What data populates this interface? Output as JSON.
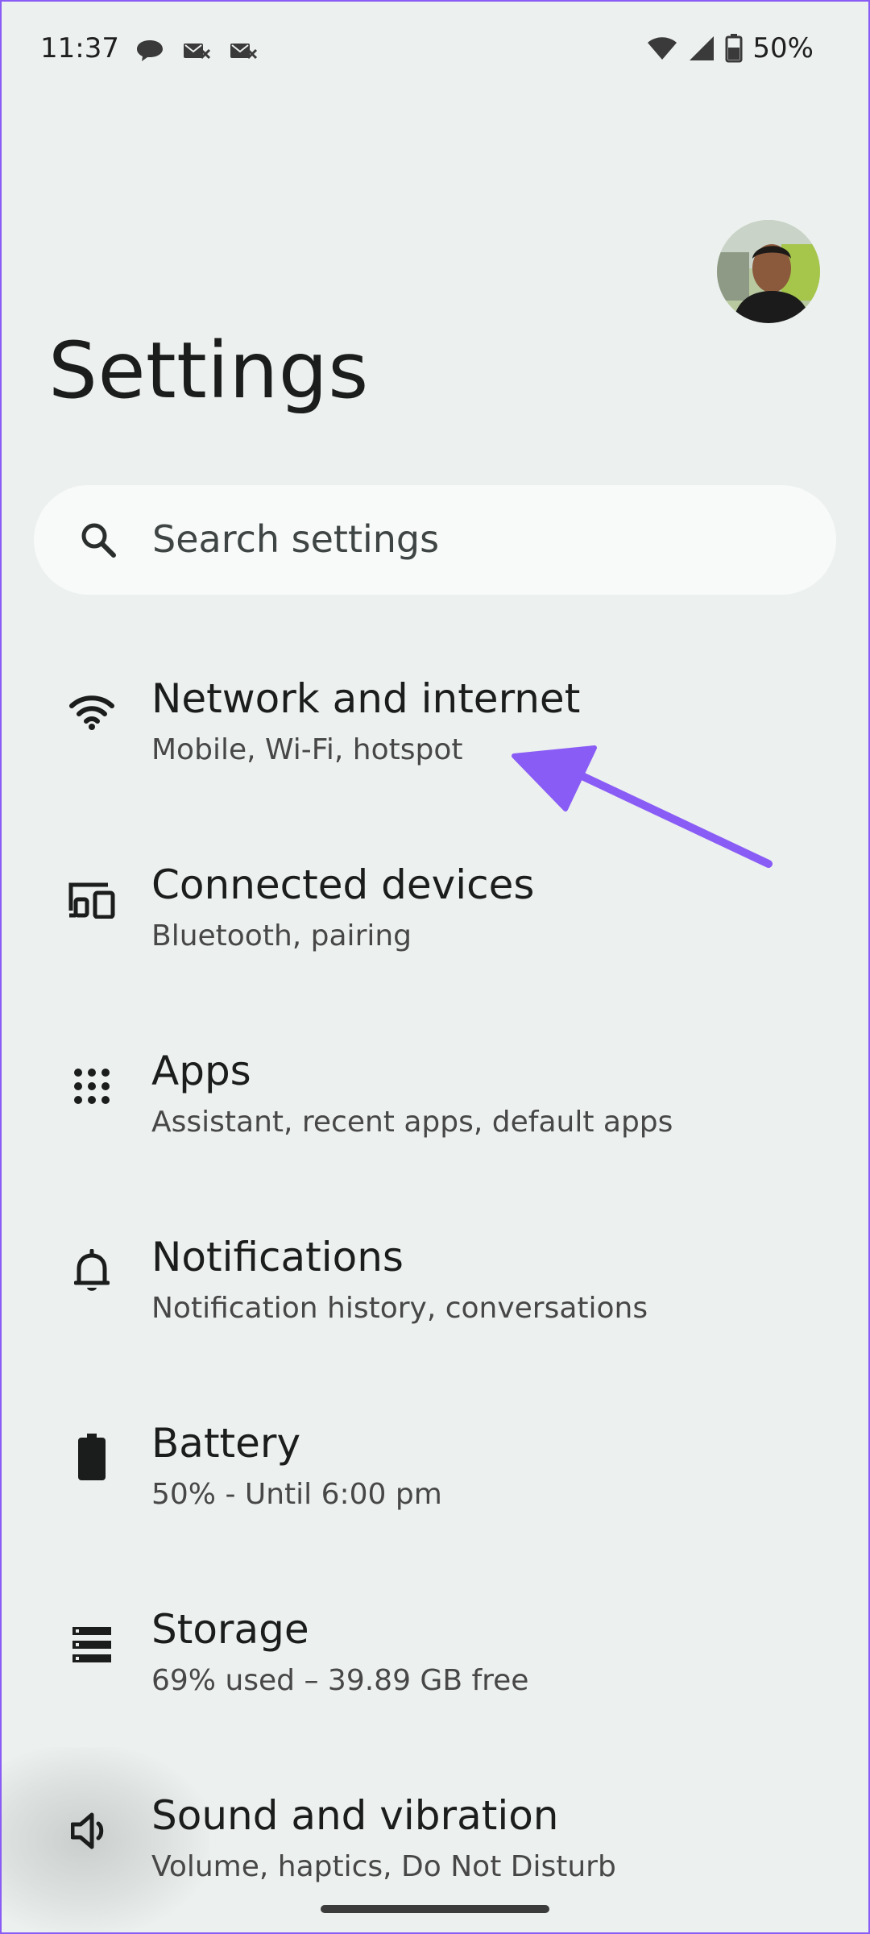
{
  "status_bar": {
    "time": "11:37",
    "battery_percent": "50%",
    "notification_icons": [
      "chat-bubble-icon",
      "mail-icon",
      "mail-icon"
    ],
    "right_icons": [
      "wifi-icon",
      "signal-icon",
      "battery-icon"
    ]
  },
  "header": {
    "title": "Settings"
  },
  "search": {
    "placeholder": "Search settings"
  },
  "settings": [
    {
      "title": "Network and internet",
      "subtitle": "Mobile, Wi-Fi, hotspot",
      "icon": "wifi-icon"
    },
    {
      "title": "Connected devices",
      "subtitle": "Bluetooth, pairing",
      "icon": "connected-devices-icon"
    },
    {
      "title": "Apps",
      "subtitle": "Assistant, recent apps, default apps",
      "icon": "apps-grid-icon"
    },
    {
      "title": "Notifications",
      "subtitle": "Notification history, conversations",
      "icon": "bell-icon"
    },
    {
      "title": "Battery",
      "subtitle": "50% - Until 6:00 pm",
      "icon": "battery-icon"
    },
    {
      "title": "Storage",
      "subtitle": "69% used – 39.89 GB free",
      "icon": "storage-icon"
    },
    {
      "title": "Sound and vibration",
      "subtitle": "Volume, haptics, Do Not Disturb",
      "icon": "speaker-icon"
    }
  ],
  "colors": {
    "background": "#ecf0ee",
    "search_background": "#f7faf8",
    "annotation_arrow": "#8a5cf6",
    "text_primary": "#1b1c1c",
    "text_secondary": "#474747"
  }
}
